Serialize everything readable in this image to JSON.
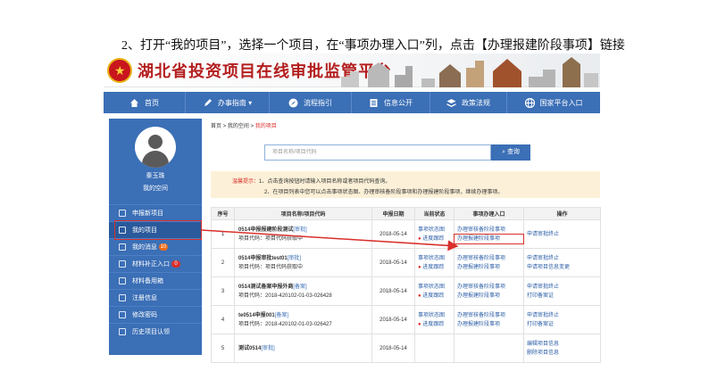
{
  "instruction": "2、打开“我的项目”，选择一个项目，在“事项办理入口”列，点击【办理报建阶段事项】链接",
  "banner": {
    "title": "湖北省投资项目在线审批监管平台",
    "emblem_icon": "national-emblem-icon"
  },
  "nav": [
    {
      "label": "首页",
      "icon": "home-icon"
    },
    {
      "label": "办事指南 ▾",
      "icon": "pen-icon"
    },
    {
      "label": "流程指引",
      "icon": "compass-icon"
    },
    {
      "label": "信息公开",
      "icon": "document-icon"
    },
    {
      "label": "政策法规",
      "icon": "layers-icon"
    },
    {
      "label": "国家平台入口",
      "icon": "globe-icon"
    }
  ],
  "sidebar": {
    "user_name": "秦玉珠",
    "user_space": "我的空间",
    "items": [
      {
        "label": "申报新项目",
        "badge": ""
      },
      {
        "label": "我的项目",
        "badge": ""
      },
      {
        "label": "我的消息",
        "badge": "10"
      },
      {
        "label": "材料补正入口",
        "badge": "0"
      },
      {
        "label": "材料备用箱",
        "badge": ""
      },
      {
        "label": "注册信息",
        "badge": ""
      },
      {
        "label": "修改密码",
        "badge": ""
      },
      {
        "label": "历史项目认领",
        "badge": ""
      }
    ]
  },
  "breadcrumb": {
    "home": "首页",
    "sep": ">",
    "space": "我的空间",
    "current": "我的项目"
  },
  "search": {
    "placeholder": "项目名称/项目代码",
    "button": "查询"
  },
  "tips": {
    "label": "温馨提示：",
    "line1": "1、点击查询按钮时请输入项目名称或者项目代码查询。",
    "line2": "2、在项目列表中您可以点击事项状态图、办理审核备阶段事项和办理报建阶段事项，继续办理事项。"
  },
  "table": {
    "headers": [
      "序号",
      "项目名称/项目代码",
      "申报日期",
      "当前状态",
      "事项办理入口",
      "操作"
    ],
    "rows": [
      {
        "no": "1",
        "name": "0514申报报建阶段测试",
        "tag": "[审批]",
        "code": "项目代码：项目代码获取中",
        "date": "2018-05-14",
        "status1": "事项状态图",
        "status2": "进度跟踪",
        "entry1": "办理审核备阶段事项",
        "entry2": "办理报建阶段事项",
        "op1": "申请审批终止",
        "op2": ""
      },
      {
        "no": "2",
        "name": "0514申报审批test01",
        "tag": "[审批]",
        "code": "项目代码：项目代码获取中",
        "date": "2018-05-14",
        "status1": "事项状态图",
        "status2": "进度跟踪",
        "entry1": "办理审核备阶段事项",
        "entry2": "办理报建阶段事项",
        "op1": "申请审批终止",
        "op2": "申请项目信息变更"
      },
      {
        "no": "3",
        "name": "0514测试备案申报外商",
        "tag": "[备案]",
        "code": "项目代码：2018-420102-01-03-026428",
        "date": "2018-05-14",
        "status1": "事项状态图",
        "status2": "进度跟踪",
        "entry1": "办理审核备阶段事项",
        "entry2": "办理报建阶段事项",
        "op1": "申请审批终止",
        "op2": "打印备案证"
      },
      {
        "no": "4",
        "name": "te0514申报001",
        "tag": "[备案]",
        "code": "项目代码：2018-420102-01-03-026427",
        "date": "2018-05-14",
        "status1": "事项状态图",
        "status2": "进度跟踪",
        "entry1": "办理审核备阶段事项",
        "entry2": "办理报建阶段事项",
        "op1": "申请审批终止",
        "op2": "打印备案证"
      },
      {
        "no": "5",
        "name": "测试0514",
        "tag": "[审批]",
        "code": "",
        "date": "2018-05-14",
        "status1": "",
        "status2": "",
        "entry1": "",
        "entry2": "",
        "op1": "编辑项目信息",
        "op2": "删除项目信息"
      }
    ]
  },
  "colors": {
    "nav_blue": "#3b6fb6",
    "highlight_red": "#d9302b",
    "title_red": "#b41e1e",
    "tips_bg": "#fcf1d8"
  }
}
